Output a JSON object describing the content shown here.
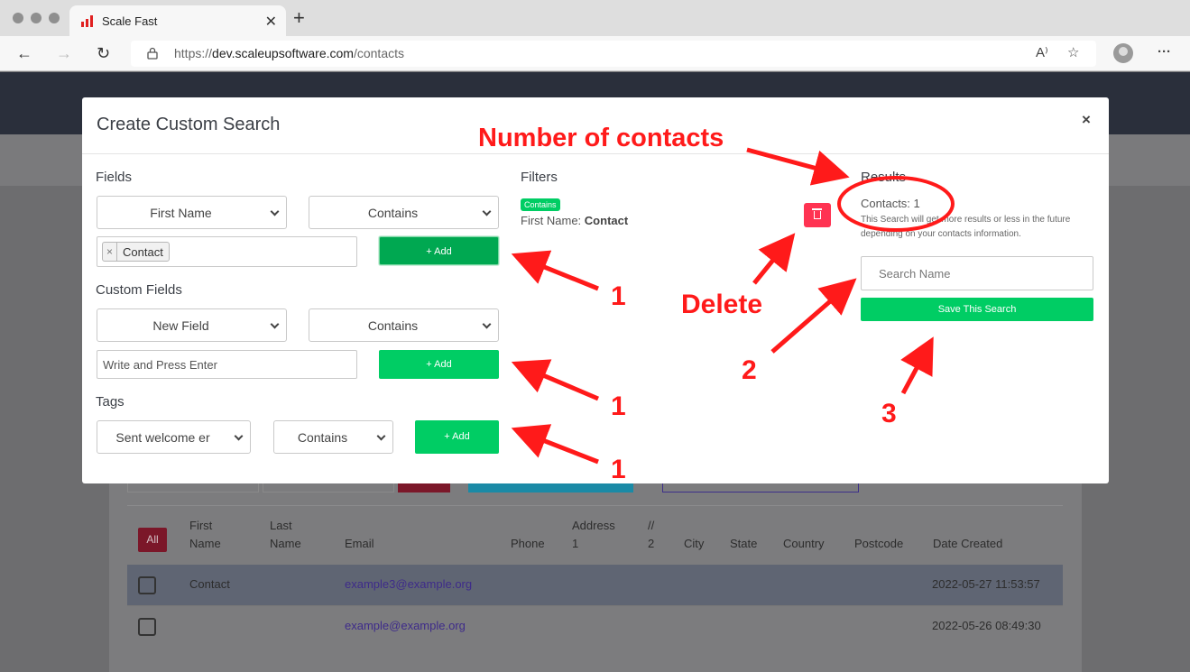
{
  "browser": {
    "tab_title": "Scale Fast",
    "url_protocol": "https://",
    "url_domain": "dev.scaleupsoftware.com",
    "url_path": "/contacts"
  },
  "modal": {
    "title": "Create Custom Search",
    "close_label": "×",
    "fields": {
      "label": "Fields",
      "field_select": "First Name",
      "operator_select": "Contains",
      "chip_remove": "×",
      "chip_value": "Contact",
      "add_label": "+ Add"
    },
    "custom_fields": {
      "label": "Custom Fields",
      "field_select": "New Field",
      "operator_select": "Contains",
      "input_placeholder": "Write and Press Enter",
      "add_label": "+ Add"
    },
    "tags": {
      "label": "Tags",
      "tag_select": "Sent welcome er",
      "operator_select": "Contains",
      "add_label": "+ Add"
    },
    "filters": {
      "label": "Filters",
      "badge": "Contains",
      "field_name": "First Name:",
      "field_value": "Contact"
    },
    "results": {
      "label": "Results",
      "contacts_count": "Contacts: 1",
      "note": "This Search will get more results or less in the future depending on your contacts information.",
      "search_name_placeholder": "Search Name",
      "save_label": "Save This Search"
    }
  },
  "table": {
    "all_label": "All",
    "headers": [
      {
        "line1": "First",
        "line2": "Name"
      },
      {
        "line1": "Last",
        "line2": "Name"
      },
      {
        "line1": "",
        "line2": "Email"
      },
      {
        "line1": "",
        "line2": "Phone"
      },
      {
        "line1": "Address",
        "line2": "1"
      },
      {
        "line1": "//",
        "line2": "2"
      },
      {
        "line1": "",
        "line2": "City"
      },
      {
        "line1": "",
        "line2": "State"
      },
      {
        "line1": "",
        "line2": "Country"
      },
      {
        "line1": "",
        "line2": "Postcode"
      },
      {
        "line1": "",
        "line2": "Date Created"
      }
    ],
    "rows": [
      {
        "first_name": "Contact",
        "email": "example3@example.org",
        "date_created": "2022-05-27 11:53:57"
      },
      {
        "first_name": "",
        "email": "example@example.org",
        "date_created": "2022-05-26 08:49:30"
      }
    ]
  },
  "annotations": {
    "number_of_contacts": "Number of contacts",
    "delete": "Delete",
    "step_1a": "1",
    "step_1b": "1",
    "step_1c": "1",
    "step_2": "2",
    "step_3": "3",
    "color": "#ff1a1a"
  }
}
